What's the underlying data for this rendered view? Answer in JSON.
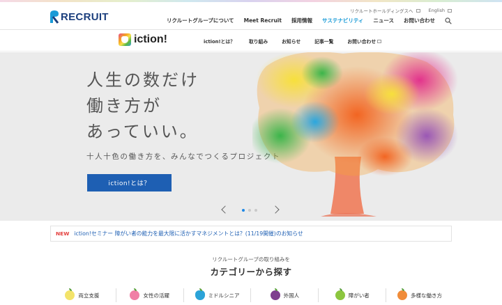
{
  "header": {
    "logo_text": "RECRUIT",
    "util_links": [
      "リクルートホールディングスへ",
      "English"
    ],
    "nav": [
      {
        "label": "リクルートグループについて",
        "active": false
      },
      {
        "label": "Meet Recruit",
        "active": false
      },
      {
        "label": "採用情報",
        "active": false
      },
      {
        "label": "サステナビリティ",
        "active": true
      },
      {
        "label": "ニュース",
        "active": false
      },
      {
        "label": "お問い合わせ",
        "active": false
      }
    ]
  },
  "subnav": {
    "logo_text": "iction!",
    "links": [
      "iction!とは？",
      "取り組み",
      "お知らせ",
      "記事一覧",
      "お問い合わせ"
    ]
  },
  "hero": {
    "title_lines": [
      "人生の数だけ",
      "働き方が",
      "あっていい。"
    ],
    "subtitle": "十人十色の働き方を、みんなでつくるプロジェクト",
    "button_label": "iction!とは？",
    "slide_count": 3,
    "active_slide": 0
  },
  "news": {
    "badge": "NEW",
    "text": "iction!セミナー 障がい者の能力を最大限に活かすマネジメントとは？(11/19開催)のお知らせ"
  },
  "categories": {
    "eyebrow": "リクルートグループの取り組みを",
    "title": "カテゴリーから探す",
    "items": [
      {
        "label": "両立支援",
        "color": "#f3e36a",
        "icon": "lemon-icon"
      },
      {
        "label": "女性の活躍",
        "color": "#f07fa6",
        "icon": "peach-icon"
      },
      {
        "label": "ミドルシニア",
        "color": "#2ba3d8",
        "icon": "blue-fruit-icon"
      },
      {
        "label": "外国人",
        "color": "#7f3f8f",
        "icon": "plum-icon"
      },
      {
        "label": "障がい者",
        "color": "#8cc63f",
        "icon": "apple-icon"
      },
      {
        "label": "多様な働き方",
        "color": "#f08c3a",
        "icon": "orange-icon"
      }
    ]
  },
  "colors": {
    "brand_blue": "#1e5fb3",
    "accent_cyan": "#1a9bd7",
    "new_red": "#e4413f"
  }
}
